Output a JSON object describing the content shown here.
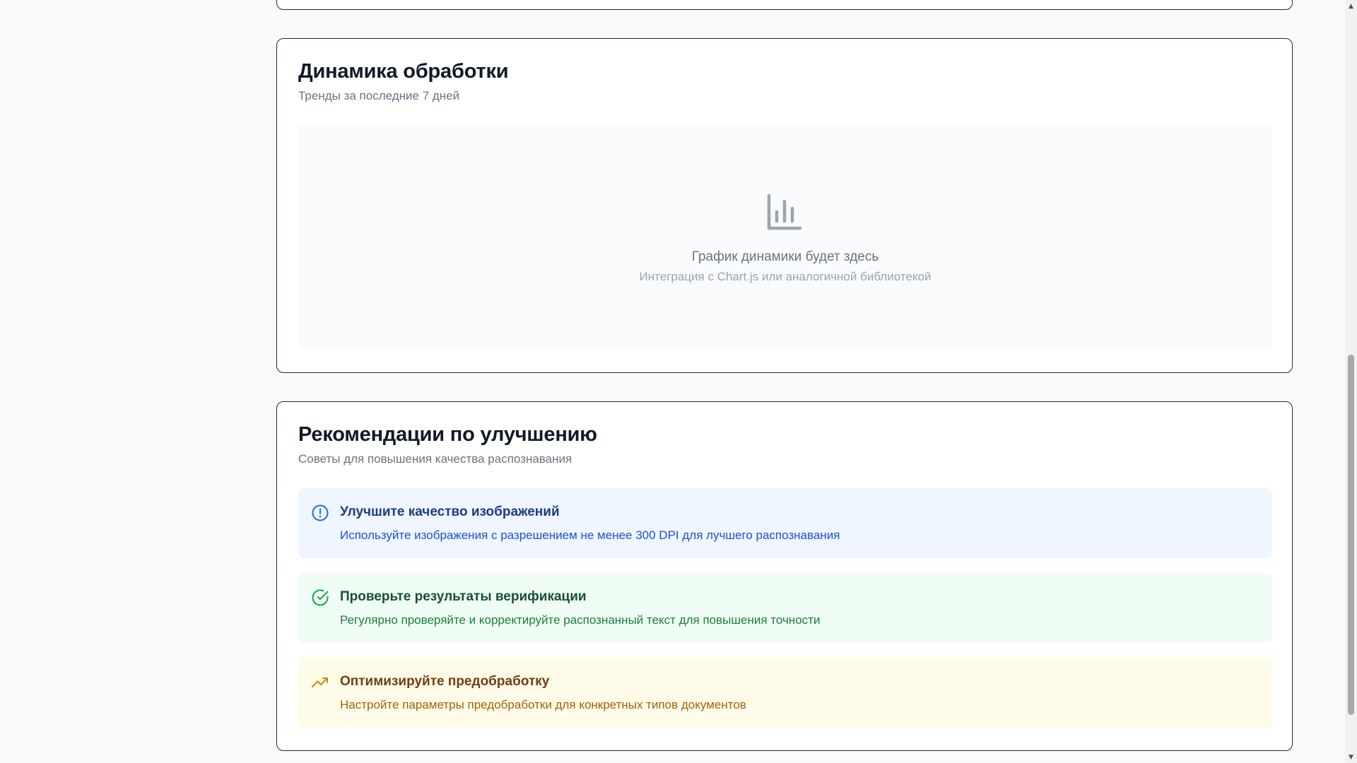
{
  "dynamics": {
    "title": "Динамика обработки",
    "subtitle": "Тренды за последние 7 дней",
    "placeholder": {
      "icon": "bar-chart-icon",
      "main_text": "График динамики будет здесь",
      "sub_text": "Интеграция с Chart.js или аналогичной библиотекой"
    }
  },
  "recommendations": {
    "title": "Рекомендации по улучшению",
    "subtitle": "Советы для повышения качества распознавания",
    "items": [
      {
        "icon": "alert-circle-icon",
        "title": "Улучшите качество изображений",
        "description": "Используйте изображения с разрешением не менее 300 DPI для лучшего распознавания",
        "color": "#2563eb",
        "background": "#eff6ff"
      },
      {
        "icon": "check-circle-icon",
        "title": "Проверьте результаты верификации",
        "description": "Регулярно проверяйте и корректируйте распознанный текст для повышения точности",
        "color": "#16a34a",
        "background": "#f0fdf4"
      },
      {
        "icon": "trending-up-icon",
        "title": "Оптимизируйте предобработку",
        "description": "Настройте параметры предобработки для конкретных типов документов",
        "color": "#ca8a04",
        "background": "#fefce8"
      }
    ]
  },
  "scrollbar": {
    "up_arrow_icon": "scroll-up-arrow-icon",
    "down_arrow_icon": "scroll-down-arrow-icon"
  }
}
